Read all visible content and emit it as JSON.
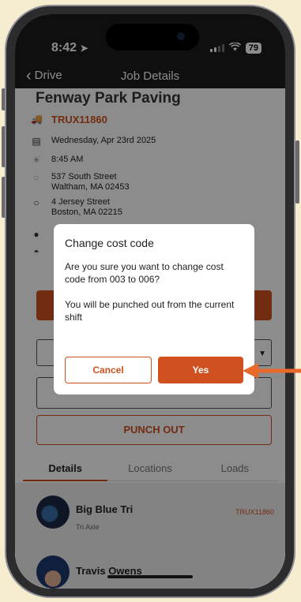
{
  "status": {
    "time": "8:42",
    "battery": "79"
  },
  "nav": {
    "back_label": "Drive",
    "title": "Job Details"
  },
  "job": {
    "title": "Fenway Park Paving",
    "truck_id": "TRUX11860",
    "date": "Wednesday, Apr 23rd  2025",
    "start_time": "8:45 AM",
    "origin_line1": "537 South Street",
    "origin_line2": "Waltham, MA 02453",
    "dest_line1": "4 Jersey Street",
    "dest_line2": "Boston, MA 02215"
  },
  "actions": {
    "punch_out": "PUNCH OUT"
  },
  "tabs": [
    {
      "label": "Details"
    },
    {
      "label": "Locations"
    },
    {
      "label": "Loads"
    }
  ],
  "list": [
    {
      "title": "Big Blue Tri",
      "subtitle": "Tri Axle",
      "tag": "TRUX11860"
    },
    {
      "title": "Travis Owens"
    }
  ],
  "dialog": {
    "title": "Change cost code",
    "message": "Are you sure you want to change cost code from 003 to 006?",
    "note": "You will be punched out from the current shift",
    "cancel_label": "Cancel",
    "confirm_label": "Yes"
  },
  "colors": {
    "accent": "#d0511f",
    "background": "#f6ecd0",
    "arrow": "#e8692a"
  }
}
